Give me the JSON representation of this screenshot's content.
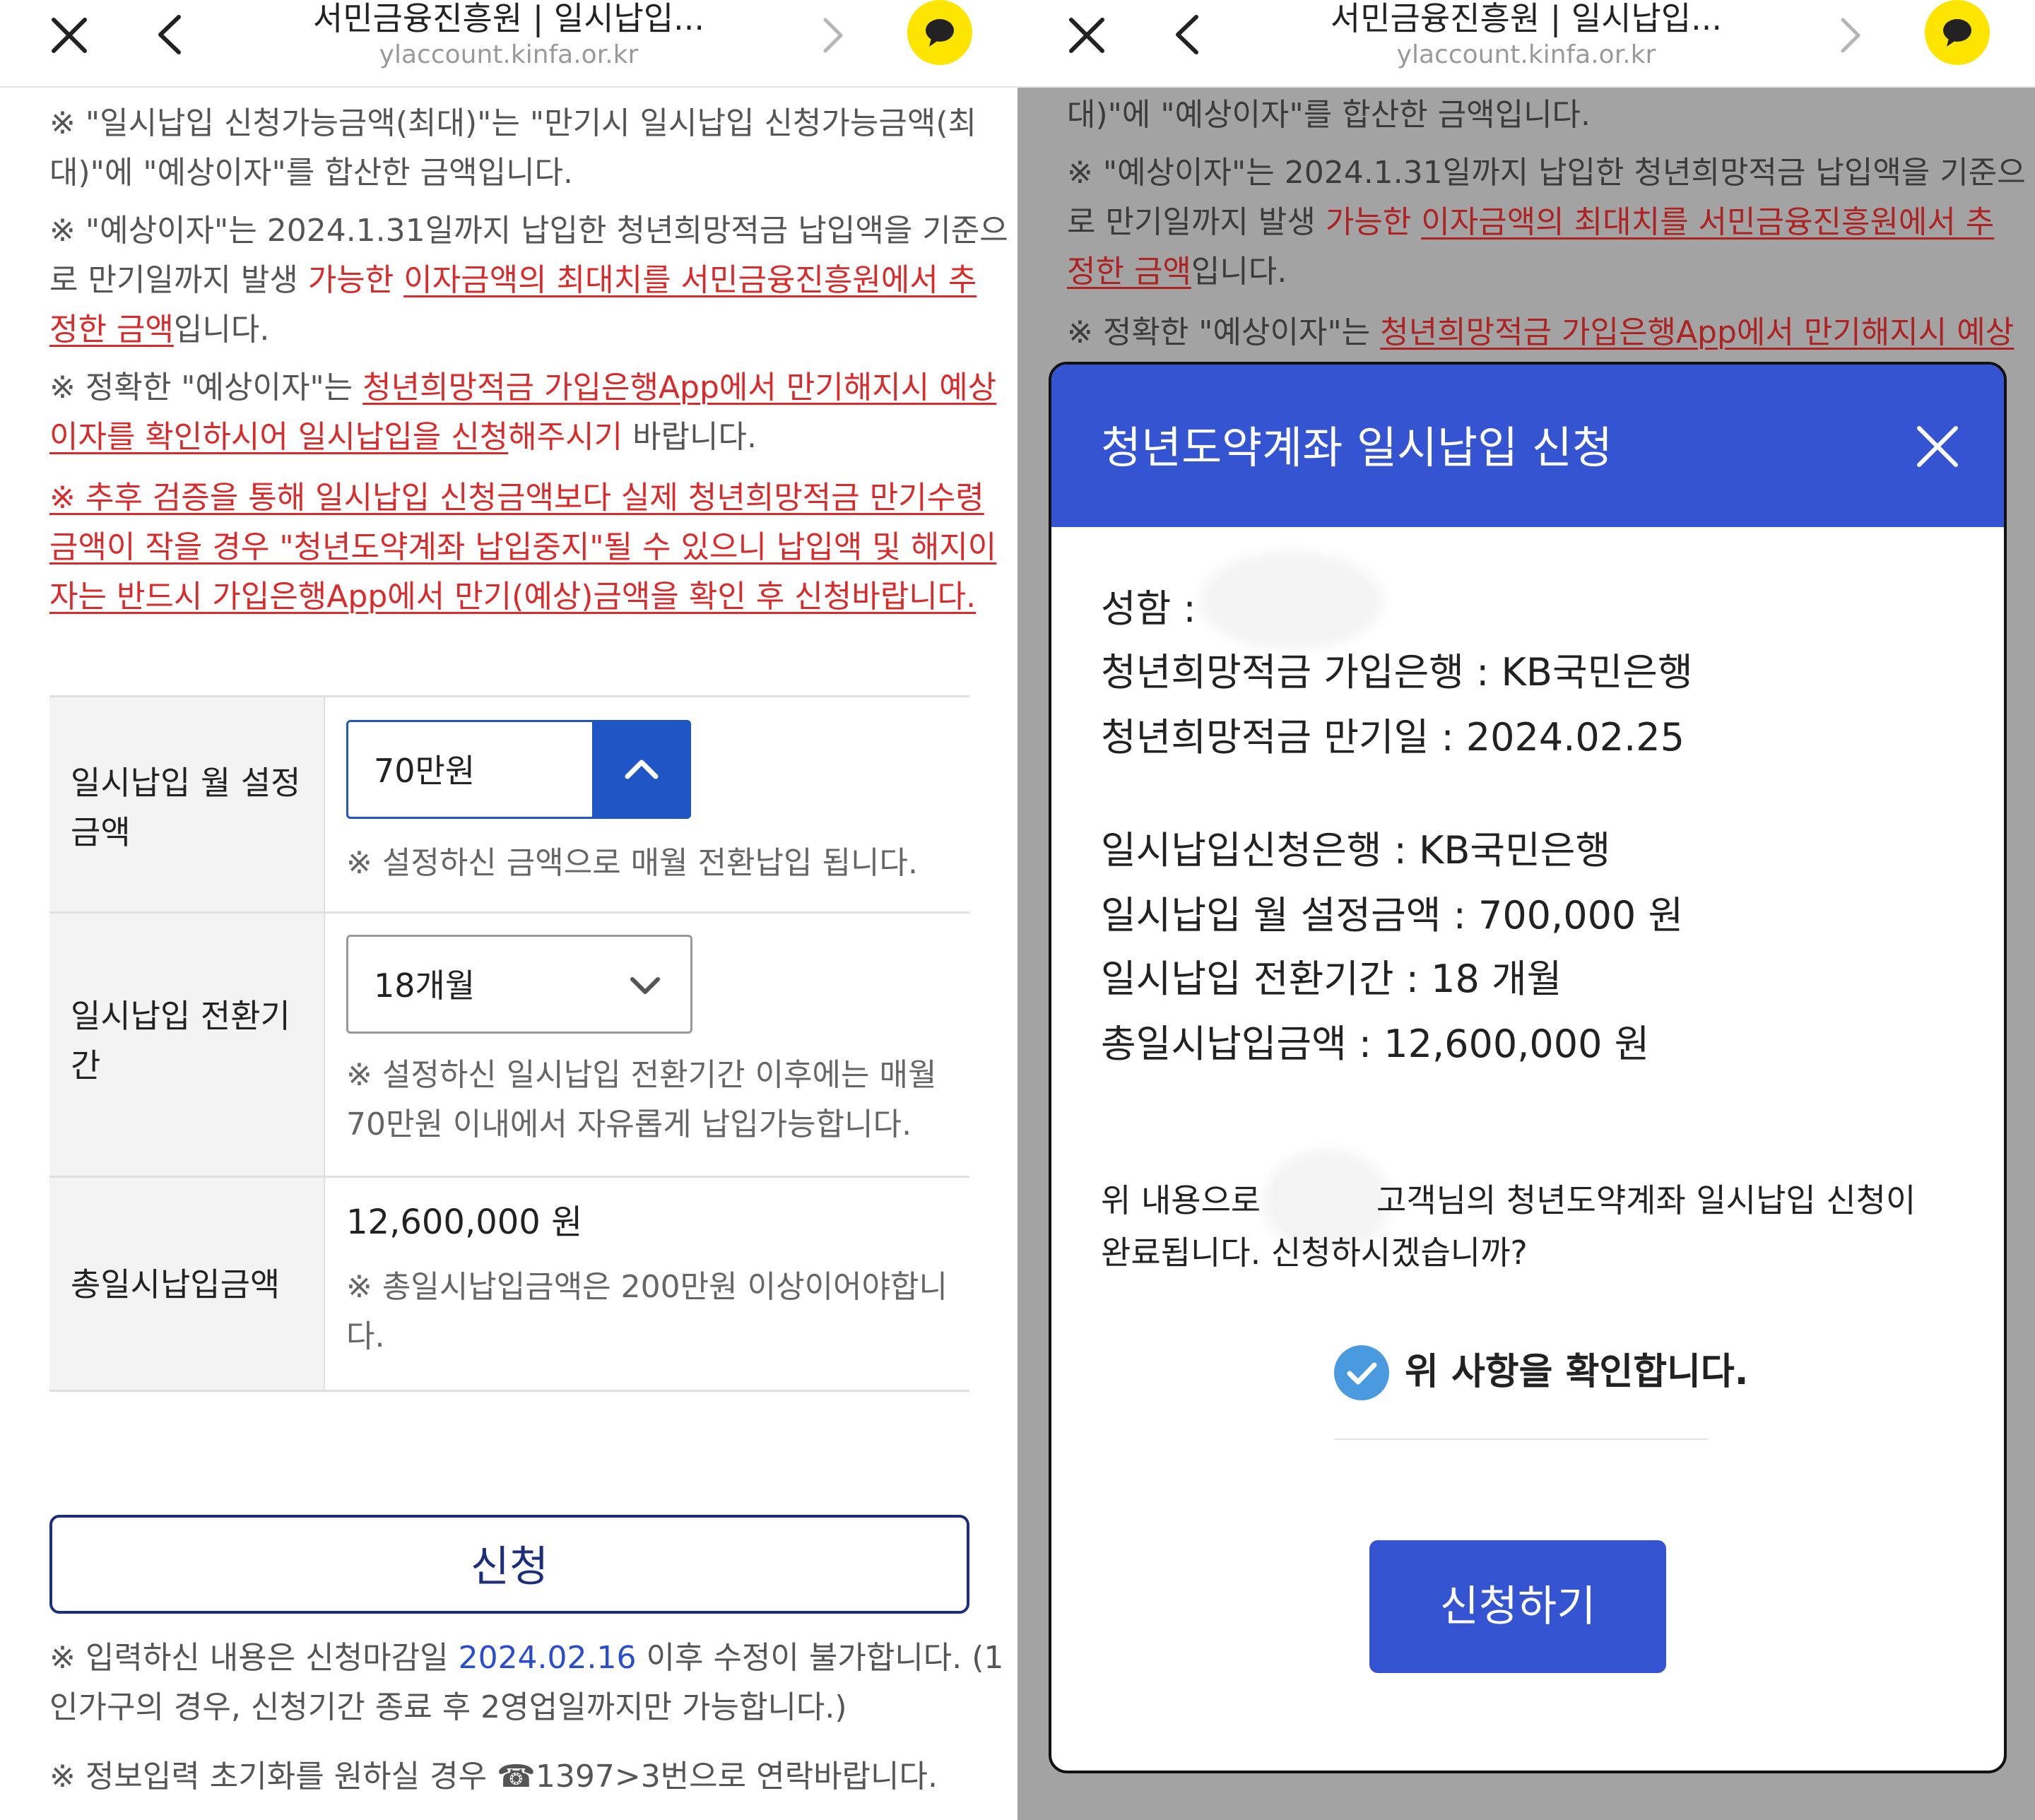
{
  "topbar": {
    "title": "서민금융진흥원 | 일시납입...",
    "url": "ylaccount.kinfa.or.kr"
  },
  "notices": {
    "n1_a": "※ \"일시납입 신청가능금액(최대)\"는 \"만기시 일시납입 신청가능금액(최",
    "n1_b": "대)\"에 \"예상이자\"를 합산한 금액입니다.",
    "n2_a": "※ \"예상이자\"는 2024.1.31일까지 납입한 청년희망적금 납입액을 기준으",
    "n2_b_pre": "로 만기일까지 발생 ",
    "n2_b_red": "가능한 ",
    "n2_b_link": "이자금액의 최대치를 서민금융진흥원에서 추",
    "n2_c_link": "정한 금액",
    "n2_c_post": "입니다.",
    "n3_a_pre": "※ 정확한 \"예상이자\"는 ",
    "n3_a_link": "청년희망적금 가입은행App에서 만기해지시 예상",
    "n3_b_link": "이자를 확인하시어 일시납입을 신청",
    "n3_b_red": "해주시기",
    "n3_b_post": " 바랍니다.",
    "n4_a": "※ 추후 검증을 통해 일시납입 신청금액보다 실제 청년희망적금 만기수령",
    "n4_b": "금액이 작을 경우 \"청년도약계좌 납입중지\"될 수 있으니 납입액 및 해지이",
    "n4_c": "자는 반드시 가입은행App에서 만기(예상)금액을 확인 후 신청바랍니다."
  },
  "form": {
    "monthly_label_1": "일시납입 월 설정",
    "monthly_label_2": "금액",
    "monthly_value": "70만원",
    "monthly_note": "※ 설정하신 금액으로 매월 전환납입 됩니다.",
    "period_label_1": "일시납입 전환기",
    "period_label_2": "간",
    "period_value": "18개월",
    "period_note_1": "※ 설정하신 일시납입 전환기간 이후에는 매월",
    "period_note_2": "70만원 이내에서 자유롭게 납입가능합니다.",
    "total_label": "총일시납입금액",
    "total_value": "12,600,000 원",
    "total_note_1": "※ 총일시납입금액은 200만원 이상이어야합니",
    "total_note_2": "다."
  },
  "apply_button": "신청",
  "footer": {
    "f1_pre": "※ 입력하신 내용은 신청마감일 ",
    "f1_date": "2024.02.16",
    "f1_post": " 이후 수정이 불가합니다. (1",
    "f1_b": "인가구의 경우, 신청기간 종료 후 2영업일까지만 가능합니다.)",
    "f2": "※ 정보입력 초기화를 원하실 경우 ☎1397>3번으로 연락바랍니다."
  },
  "right_notices": {
    "r1": "대)\"에 \"예상이자\"를 합산한 금액입니다.",
    "r2_a": "※ \"예상이자\"는 2024.1.31일까지 납입한 청년희망적금 납입액을 기준으",
    "r2_b_pre": "로 만기일까지 발생 ",
    "r2_b_red": "가능한 ",
    "r2_b_link": "이자금액의 최대치를 서민금융진흥원에서 추",
    "r2_c_link": "정한 금액",
    "r2_c_post": "입니다.",
    "r3_pre": "※ 정확한 \"예상이자\"는 ",
    "r3_link": "청년희망적금 가입은행App에서 만기해지시 예상"
  },
  "modal": {
    "title": "청년도약계좌 일시납입 신청",
    "name_label": "성함 :",
    "bank_line": "청년희망적금 가입은행 : KB국민은행",
    "maturity_line": "청년희망적금 만기일 : 2024.02.25",
    "apply_bank_line": "일시납입신청은행 : KB국민은행",
    "monthly_line": "일시납입 월 설정금액 : 700,000 원",
    "period_line": "일시납입 전환기간 : 18 개월",
    "total_line": "총일시납입금액 : 12,600,000 원",
    "confirm_a_pre": "위 내용으로",
    "confirm_a_post": "고객님의 청년도약계좌 일시납입 신청이",
    "confirm_b": "완료됩니다. 신청하시겠습니까?",
    "check_label": "위 사항을 확인합니다.",
    "submit": "신청하기"
  },
  "colors": {
    "accent_blue": "#3454d1",
    "notice_red": "#d92b2b",
    "kakao_yellow": "#fee500",
    "dim_gray": "#cccccc"
  },
  "icons": [
    "close-icon",
    "back-icon",
    "forward-icon",
    "kakaotalk-icon",
    "chevron-up-icon",
    "chevron-down-icon",
    "check-icon"
  ]
}
